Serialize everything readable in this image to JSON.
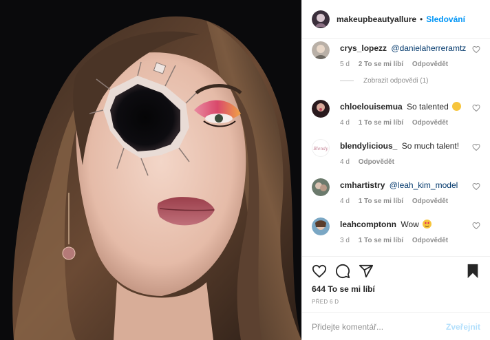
{
  "photo": {
    "alt": "makeup-photo"
  },
  "header": {
    "username": "makeupbeautyallure",
    "separator": "•",
    "follow_label": "Sledování"
  },
  "comments": [
    {
      "user": "crys_lopezz",
      "text": "",
      "mention": "@danielaherreramtz",
      "time": "5 d",
      "likes": "2 To se mi líbí",
      "reply": "Odpovědět",
      "emoji": ""
    },
    {
      "user": "chloelouisemua",
      "text": "So talented",
      "mention": "",
      "time": "4 d",
      "likes": "1 To se mi líbí",
      "reply": "Odpovědět",
      "emoji": "smiling-face"
    },
    {
      "user": "blendylicious_",
      "text": "So much talent!",
      "mention": "",
      "time": "4 d",
      "likes": "",
      "reply": "Odpovědět",
      "emoji": ""
    },
    {
      "user": "cmhartistry",
      "text": "",
      "mention": "@leah_kim_model",
      "time": "4 d",
      "likes": "1 To se mi líbí",
      "reply": "Odpovědět",
      "emoji": ""
    },
    {
      "user": "leahcomptonn",
      "text": "Wow",
      "mention": "",
      "time": "3 d",
      "likes": "1 To se mi líbí",
      "reply": "Odpovědět",
      "emoji": "heart-eyes-face"
    }
  ],
  "view_replies": "Zobrazit odpovědi (1)",
  "actions": {
    "likes_count": "644 To se mi líbí",
    "date": "PŘED 6 D"
  },
  "add_comment": {
    "placeholder": "Přidejte komentář...",
    "post_label": "Zveřejnit"
  },
  "icons": [
    "heart-icon",
    "comment-icon",
    "share-icon",
    "bookmark-icon"
  ],
  "colors": {
    "link": "#0095f6",
    "mention": "#00376b",
    "muted": "#8e8e8e",
    "post_disabled": "#b2dffc"
  }
}
